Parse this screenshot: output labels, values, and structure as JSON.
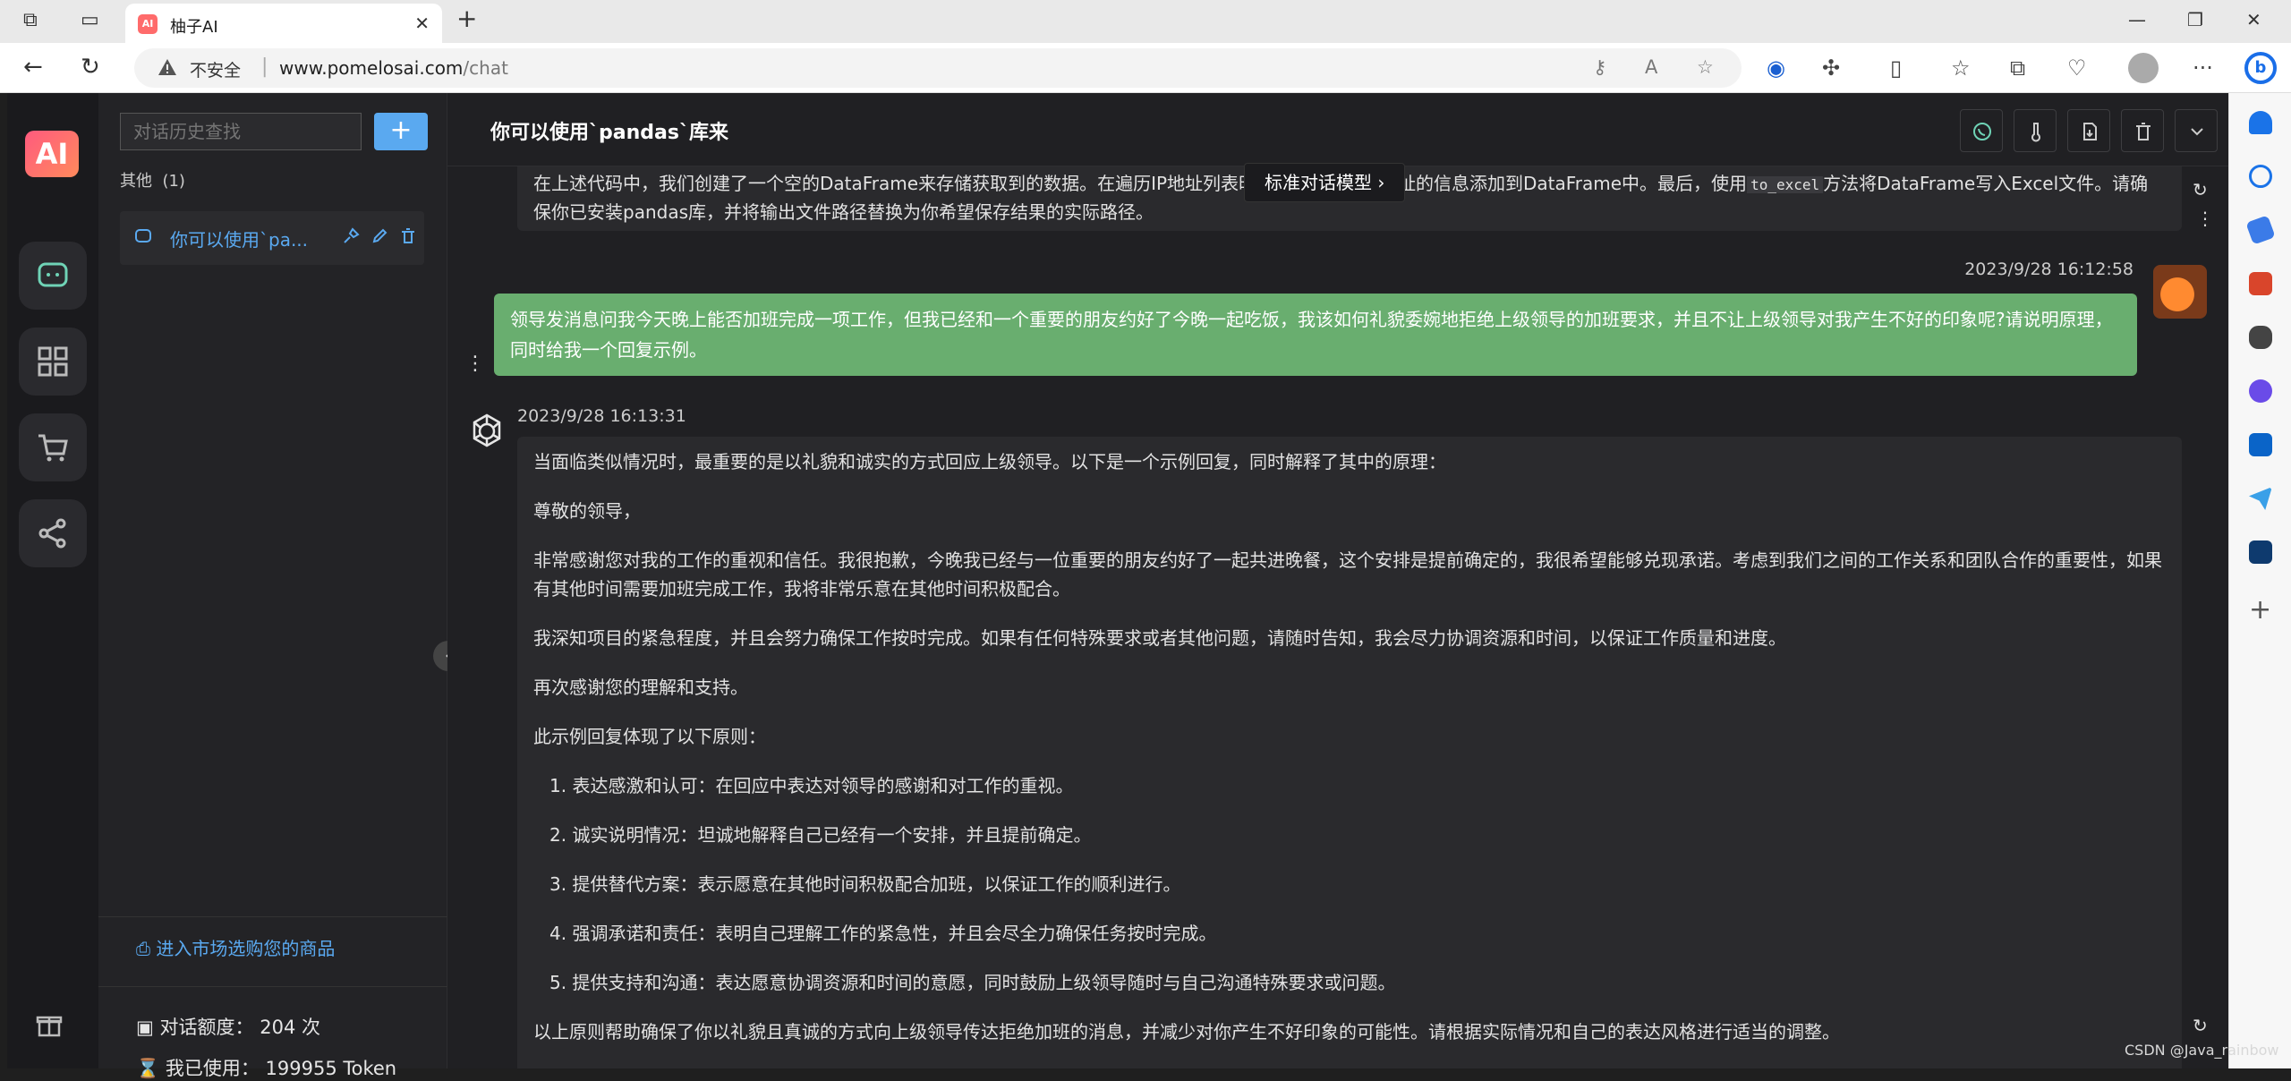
{
  "browser": {
    "tab_title": "柚子AI",
    "tab_favicon": "AI",
    "insecure_label": "不安全",
    "url_host": "www.pomelosai.com",
    "url_path": "/chat"
  },
  "rail": {
    "logo_text": "AI"
  },
  "history": {
    "search_placeholder": "对话历史查找",
    "add_label": "+",
    "group_label": "其他",
    "group_count": "(1)",
    "chat_title": "你可以使用`pa...",
    "market_link": "进入市场选购您的商品",
    "quota_label": "对话额度：",
    "quota_value": "204 次",
    "used_label": "我已使用：",
    "used_value": "199955 Token"
  },
  "main": {
    "title": "你可以使用`pandas`库来",
    "model_tag": "标准对话模型",
    "prev_message_line1": "在上述代码中，我们创建了一个空的DataFrame来存储获取到的数据。在遍历IP地址列表时，我们将每个IP地址的信息添加到DataFrame中。最后，使用",
    "prev_message_code": "to_excel",
    "prev_message_line1_end": "方法将DataFrame写入Excel文件。请确",
    "prev_message_line2": "保你已安装pandas库，并将输出文件路径替换为你希望保存结果的实际路径。",
    "user_time": "2023/9/28 16:12:58",
    "user_message": "领导发消息问我今天晚上能否加班完成一项工作，但我已经和一个重要的朋友约好了今晚一起吃饭，我该如何礼貌委婉地拒绝上级领导的加班要求，并且不让上级领导对我产生不好的印象呢?请说明原理，同时给我一个回复示例。",
    "ai_time": "2023/9/28 16:13:31",
    "ai_paragraphs": [
      "当面临类似情况时，最重要的是以礼貌和诚实的方式回应上级领导。以下是一个示例回复，同时解释了其中的原理：",
      "尊敬的领导，",
      "非常感谢您对我的工作的重视和信任。我很抱歉，今晚我已经与一位重要的朋友约好了一起共进晚餐，这个安排是提前确定的，我很希望能够兑现承诺。考虑到我们之间的工作关系和团队合作的重要性，如果有其他时间需要加班完成工作，我将非常乐意在其他时间积极配合。",
      "我深知项目的紧急程度，并且会努力确保工作按时完成。如果有任何特殊要求或者其他问题，请随时告知，我会尽力协调资源和时间，以保证工作质量和进度。",
      "再次感谢您的理解和支持。",
      "此示例回复体现了以下原则："
    ],
    "ai_list": [
      "1. 表达感激和认可：在回应中表达对领导的感谢和对工作的重视。",
      "2. 诚实说明情况：坦诚地解释自己已经有一个安排，并且提前确定。",
      "3. 提供替代方案：表示愿意在其他时间积极配合加班，以保证工作的顺利进行。",
      "4. 强调承诺和责任：表明自己理解工作的紧急性，并且会尽全力确保任务按时完成。",
      "5. 提供支持和沟通：表达愿意协调资源和时间的意愿，同时鼓励上级领导随时与自己沟通特殊要求或问题。"
    ],
    "ai_conclusion": "以上原则帮助确保了你以礼貌且真诚的方式向上级领导传达拒绝加班的消息，并减少对你产生不好印象的可能性。请根据实际情况和自己的表达风格进行适当的调整。"
  },
  "watermark": "CSDN @Java_rainbow"
}
